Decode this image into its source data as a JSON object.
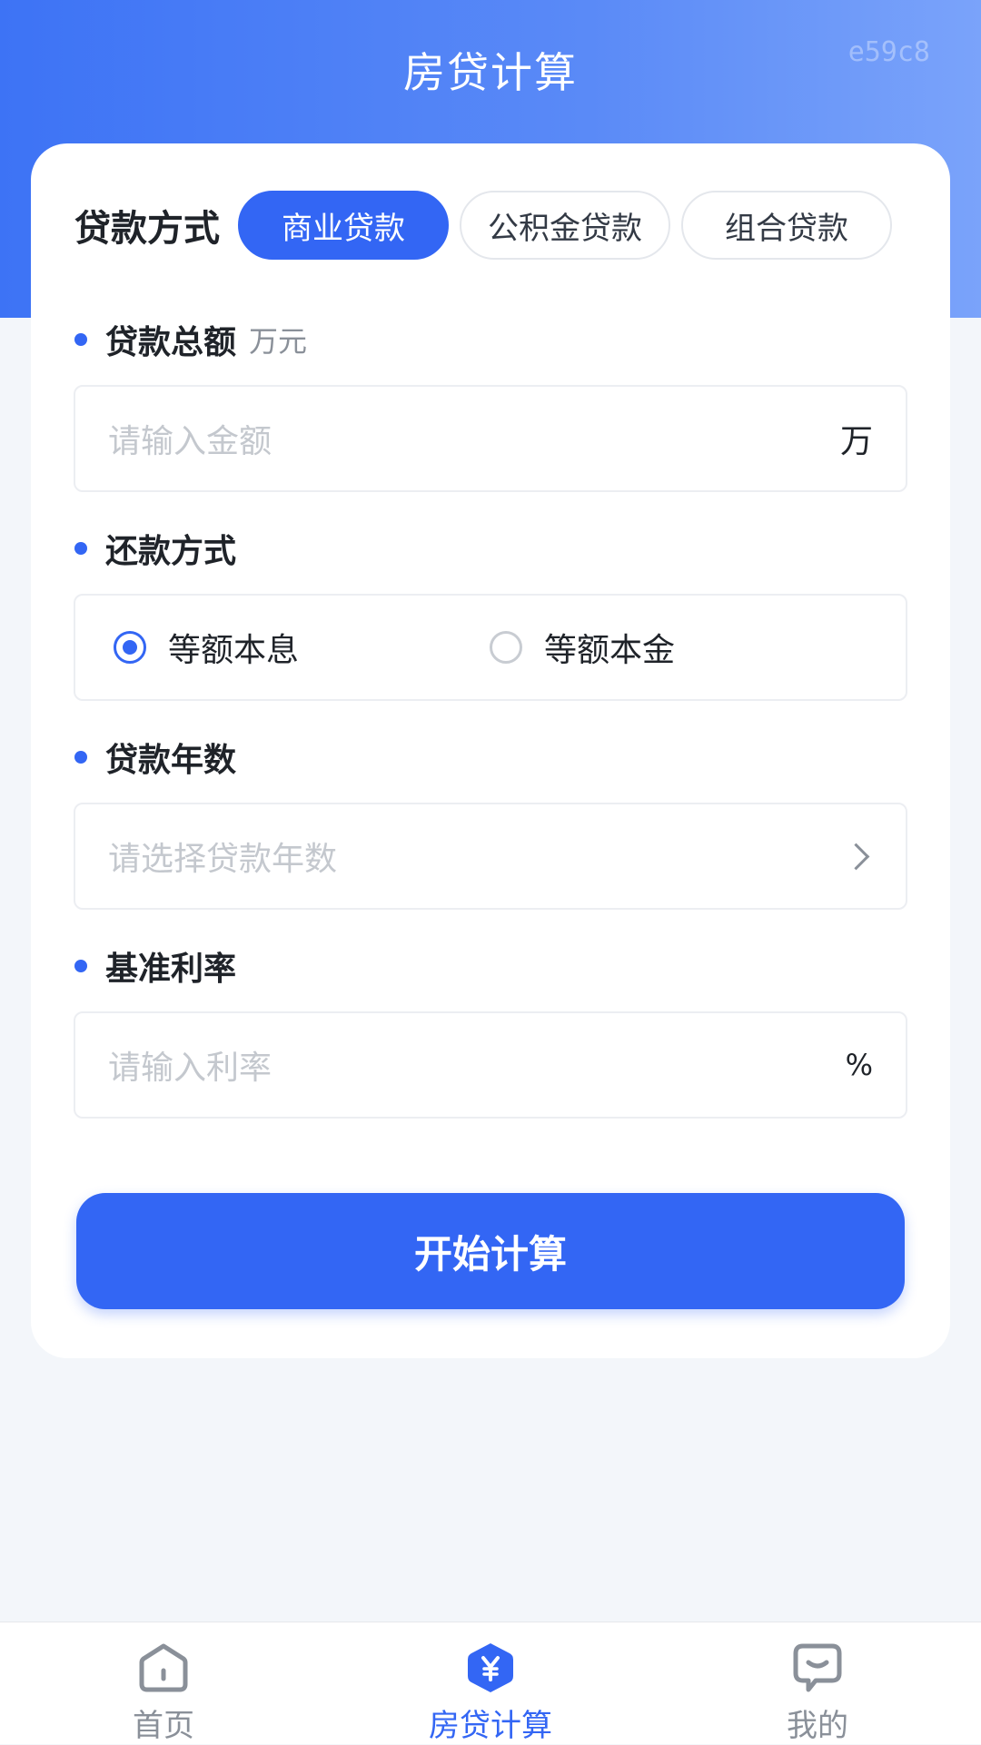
{
  "header": {
    "title": "房贷计算",
    "watermark": "e59c8"
  },
  "loan_type": {
    "label": "贷款方式",
    "options": [
      "商业贷款",
      "公积金贷款",
      "组合贷款"
    ],
    "selected": "商业贷款"
  },
  "amount": {
    "label": "贷款总额",
    "unit_hint": "万元",
    "placeholder": "请输入金额",
    "suffix": "万"
  },
  "repayment": {
    "label": "还款方式",
    "options": [
      "等额本息",
      "等额本金"
    ],
    "selected": "等额本息"
  },
  "years": {
    "label": "贷款年数",
    "placeholder": "请选择贷款年数"
  },
  "rate": {
    "label": "基准利率",
    "placeholder": "请输入利率",
    "suffix": "%"
  },
  "submit": {
    "label": "开始计算"
  },
  "tabbar": {
    "items": [
      {
        "label": "首页",
        "icon": "home-icon"
      },
      {
        "label": "房贷计算",
        "icon": "yuan-icon"
      },
      {
        "label": "我的",
        "icon": "chat-smile-icon"
      }
    ],
    "active": "房贷计算"
  },
  "colors": {
    "primary": "#3366f4",
    "header_start": "#3d73f5",
    "header_end": "#7aa3fa",
    "inactive_icon": "#8a9099"
  }
}
